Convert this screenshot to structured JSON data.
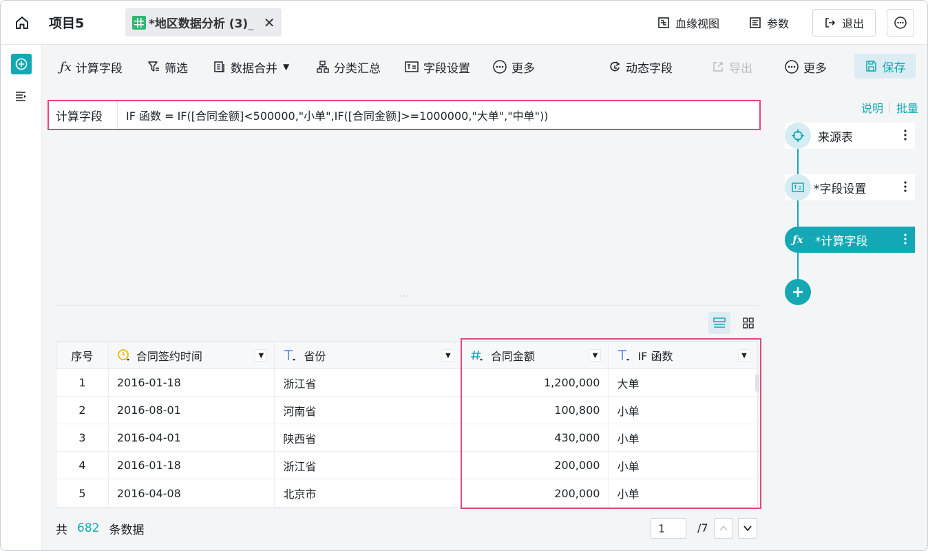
{
  "header": {
    "project": "项目5",
    "tab_title": "*地区数据分析 (3)",
    "tab_title_overflow": "_",
    "close": "✕",
    "lineage": "血缘视图",
    "params": "参数",
    "exit": "退出"
  },
  "toolbar": {
    "calc_field": "计算字段",
    "filter": "筛选",
    "merge": "数据合并",
    "group_summary": "分类汇总",
    "field_settings": "字段设置",
    "more_left": "更多",
    "dynamic_field": "动态字段",
    "export": "导出",
    "more_right": "更多",
    "save": "保存"
  },
  "formula": {
    "label": "计算字段",
    "expression": "IF 函数 = IF([合同金额]<500000,\"小单\",IF([合同金额]>=1000000,\"大单\",\"中单\"))"
  },
  "table": {
    "columns": [
      "序号",
      "合同签约时间",
      "省份",
      "合同金额",
      "IF 函数"
    ],
    "rows": [
      [
        "1",
        "2016-01-18",
        "浙江省",
        "1,200,000",
        "大单"
      ],
      [
        "2",
        "2016-08-01",
        "河南省",
        "100,800",
        "小单"
      ],
      [
        "3",
        "2016-04-01",
        "陕西省",
        "430,000",
        "小单"
      ],
      [
        "4",
        "2016-01-18",
        "浙江省",
        "200,000",
        "小单"
      ],
      [
        "5",
        "2016-04-08",
        "北京市",
        "200,000",
        "小单"
      ]
    ]
  },
  "footer": {
    "prefix": "共",
    "count": "682",
    "suffix": "条数据",
    "page": "1",
    "total_pages": "/7"
  },
  "side": {
    "explain": "说明",
    "batch": "批量",
    "steps": [
      "来源表",
      "*字段设置",
      "*计算字段"
    ]
  },
  "colors": {
    "accent": "#14a8b4",
    "highlight": "#e8447a"
  }
}
